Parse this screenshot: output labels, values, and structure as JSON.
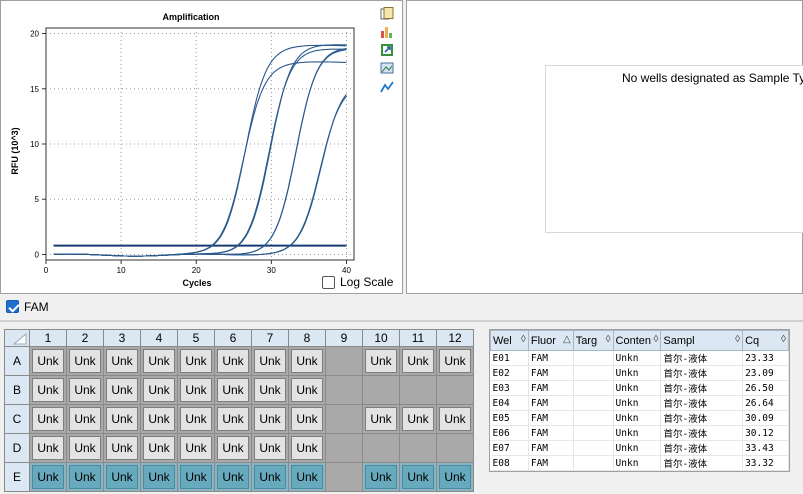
{
  "chart_data": {
    "type": "line",
    "title": "Amplification",
    "xlabel": "Cycles",
    "ylabel": "RFU (10^3)",
    "xlim": [
      0,
      41
    ],
    "ylim": [
      -0.5,
      20.5
    ],
    "xticks": [
      0,
      10,
      20,
      30,
      40
    ],
    "yticks": [
      0,
      5,
      10,
      15,
      20
    ],
    "threshold": 0.8,
    "series": [
      {
        "well": "E01",
        "cq": 23.33,
        "plateau": 18.9
      },
      {
        "well": "E02",
        "cq": 23.09,
        "plateau": 17.4
      },
      {
        "well": "E03",
        "cq": 26.5,
        "plateau": 18.6
      },
      {
        "well": "E04",
        "cq": 26.64,
        "plateau": 19.0
      },
      {
        "well": "E05",
        "cq": 30.09,
        "plateau": 18.7
      },
      {
        "well": "E06",
        "cq": 30.12,
        "plateau": 18.8
      },
      {
        "well": "E07",
        "cq": 33.43,
        "plateau": 15.8
      },
      {
        "well": "E08",
        "cq": 33.32,
        "plateau": 15.5
      }
    ],
    "line_color": "#2a5a8c"
  },
  "toolbar_icons": [
    "copy-icon",
    "bar-chart-icon",
    "export-icon",
    "image-icon",
    "line-trend-icon"
  ],
  "log_scale_label": "Log Scale",
  "sample_type_message": "No wells designated as Sample Type",
  "fluor_filter": {
    "label": "FAM",
    "checked": true
  },
  "plate": {
    "columns": [
      "1",
      "2",
      "3",
      "4",
      "5",
      "6",
      "7",
      "8",
      "9",
      "10",
      "11",
      "12"
    ],
    "rows": [
      {
        "label": "A",
        "wells": [
          "Unk",
          "Unk",
          "Unk",
          "Unk",
          "Unk",
          "Unk",
          "Unk",
          "Unk",
          "",
          "Unk",
          "Unk",
          "Unk"
        ],
        "selected": false
      },
      {
        "label": "B",
        "wells": [
          "Unk",
          "Unk",
          "Unk",
          "Unk",
          "Unk",
          "Unk",
          "Unk",
          "Unk",
          "",
          "",
          "",
          ""
        ],
        "selected": false
      },
      {
        "label": "C",
        "wells": [
          "Unk",
          "Unk",
          "Unk",
          "Unk",
          "Unk",
          "Unk",
          "Unk",
          "Unk",
          "",
          "Unk",
          "Unk",
          "Unk"
        ],
        "selected": false
      },
      {
        "label": "D",
        "wells": [
          "Unk",
          "Unk",
          "Unk",
          "Unk",
          "Unk",
          "Unk",
          "Unk",
          "Unk",
          "",
          "",
          "",
          ""
        ],
        "selected": false
      },
      {
        "label": "E",
        "wells": [
          "Unk",
          "Unk",
          "Unk",
          "Unk",
          "Unk",
          "Unk",
          "Unk",
          "Unk",
          "",
          "Unk",
          "Unk",
          "Unk"
        ],
        "selected": true
      }
    ]
  },
  "grid": {
    "headers": [
      "Wel",
      "Fluor",
      "Targ",
      "Conten",
      "Sampl",
      "Cq"
    ],
    "rows": [
      [
        "E01",
        "FAM",
        "",
        "Unkn",
        "首尔-液体",
        "23.33"
      ],
      [
        "E02",
        "FAM",
        "",
        "Unkn",
        "首尔-液体",
        "23.09"
      ],
      [
        "E03",
        "FAM",
        "",
        "Unkn",
        "首尔-液体",
        "26.50"
      ],
      [
        "E04",
        "FAM",
        "",
        "Unkn",
        "首尔-液体",
        "26.64"
      ],
      [
        "E05",
        "FAM",
        "",
        "Unkn",
        "首尔-液体",
        "30.09"
      ],
      [
        "E06",
        "FAM",
        "",
        "Unkn",
        "首尔-液体",
        "30.12"
      ],
      [
        "E07",
        "FAM",
        "",
        "Unkn",
        "首尔-液体",
        "33.43"
      ],
      [
        "E08",
        "FAM",
        "",
        "Unkn",
        "首尔-液体",
        "33.32"
      ]
    ]
  }
}
